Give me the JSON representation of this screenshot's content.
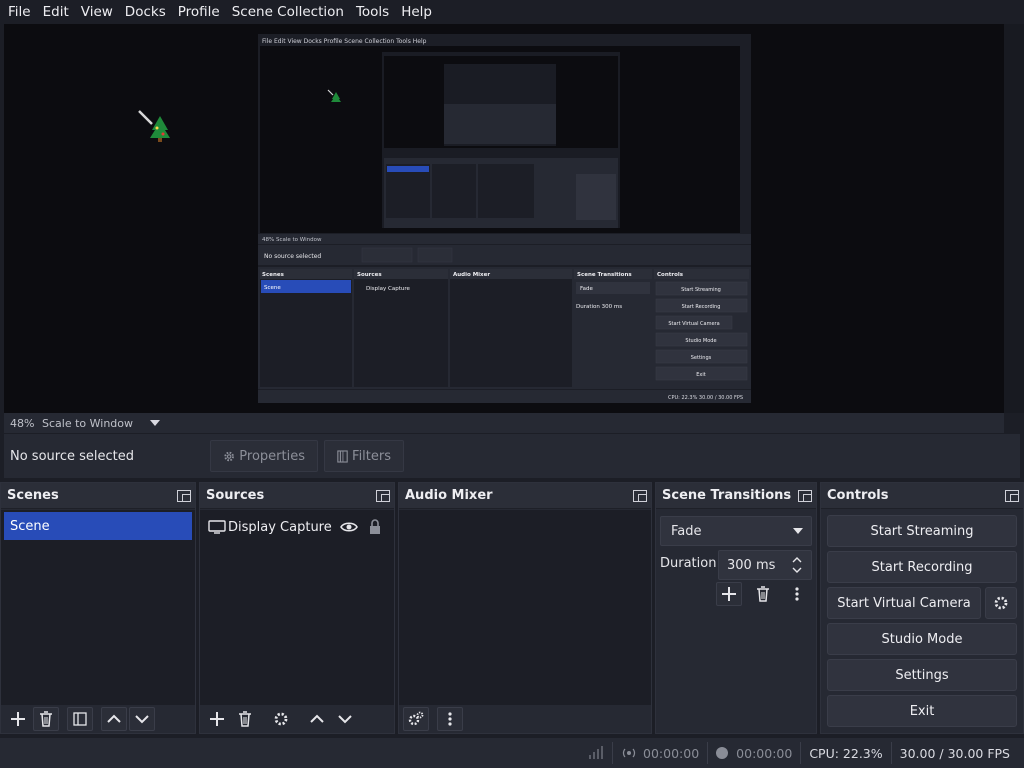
{
  "menu": [
    "File",
    "Edit",
    "View",
    "Docks",
    "Profile",
    "Scene Collection",
    "Tools",
    "Help"
  ],
  "preview": {
    "zoom": "48%",
    "scale_mode": "Scale to Window"
  },
  "properties_bar": {
    "no_source": "No source selected",
    "properties_label": "Properties",
    "filters_label": "Filters"
  },
  "docks": {
    "scenes": {
      "title": "Scenes",
      "items": [
        "Scene"
      ]
    },
    "sources": {
      "title": "Sources",
      "items": [
        {
          "name": "Display Capture",
          "visible_icon": "eye-icon",
          "lock_icon": "lock-icon"
        }
      ]
    },
    "audio_mixer": {
      "title": "Audio Mixer"
    },
    "transitions": {
      "title": "Scene Transitions",
      "transition": "Fade",
      "duration_label": "Duration",
      "duration_value": "300 ms"
    },
    "controls": {
      "title": "Controls",
      "start_streaming": "Start Streaming",
      "start_recording": "Start Recording",
      "start_virtual_camera": "Start Virtual Camera",
      "studio_mode": "Studio Mode",
      "settings": "Settings",
      "exit": "Exit"
    }
  },
  "status": {
    "stream_time": "00:00:00",
    "record_time": "00:00:00",
    "cpu": "CPU: 22.3%",
    "fps": "30.00 / 30.00 FPS"
  },
  "colors": {
    "accent": "#284cb8",
    "background": "#1c1e26",
    "panel": "#262933"
  }
}
